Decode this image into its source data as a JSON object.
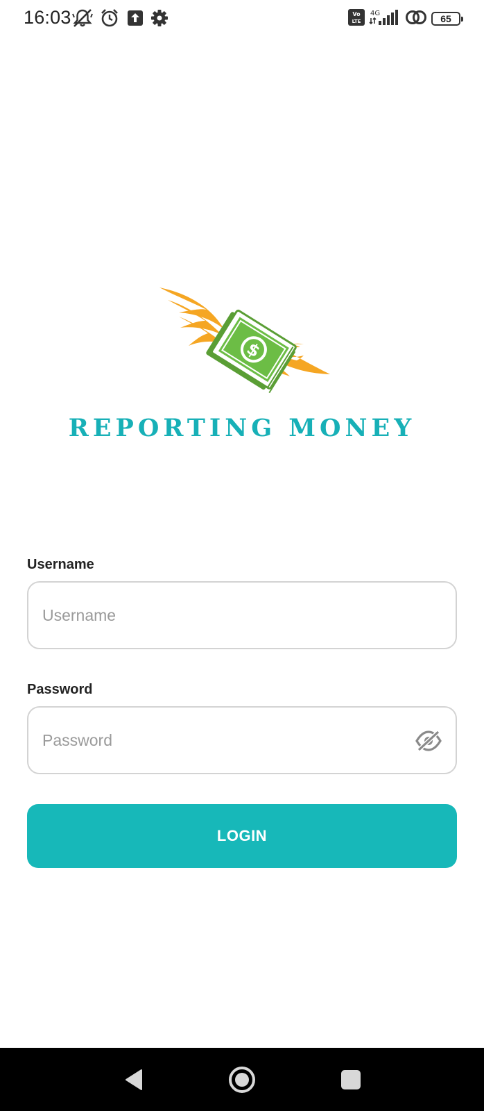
{
  "status_bar": {
    "time": "16:03",
    "icons": [
      "notifications-off-icon",
      "alarm-icon",
      "upload-icon",
      "settings-gear-icon"
    ],
    "right_icons": [
      "volte-icon",
      "4g-signal-icon",
      "link-icon",
      "battery-icon"
    ],
    "network_label": "4G",
    "volte_label": "Vo LTE",
    "battery_level": "65"
  },
  "logo": {
    "title": "REPORTING MONEY",
    "icon": "flying-money-icon",
    "colors": {
      "text": "#17b0b7",
      "wings": "#f5a623",
      "bill": "#6cbd45"
    }
  },
  "form": {
    "username_label": "Username",
    "username_placeholder": "Username",
    "username_value": "",
    "password_label": "Password",
    "password_placeholder": "Password",
    "password_value": "",
    "password_toggle_icon": "eye-off-icon",
    "login_label": "LOGIN"
  },
  "nav_bar": {
    "buttons": [
      "back-icon",
      "home-icon",
      "recents-icon"
    ]
  },
  "colors": {
    "accent": "#17b8b9",
    "border": "#d3d3d3",
    "placeholder": "#9a9a9a"
  }
}
